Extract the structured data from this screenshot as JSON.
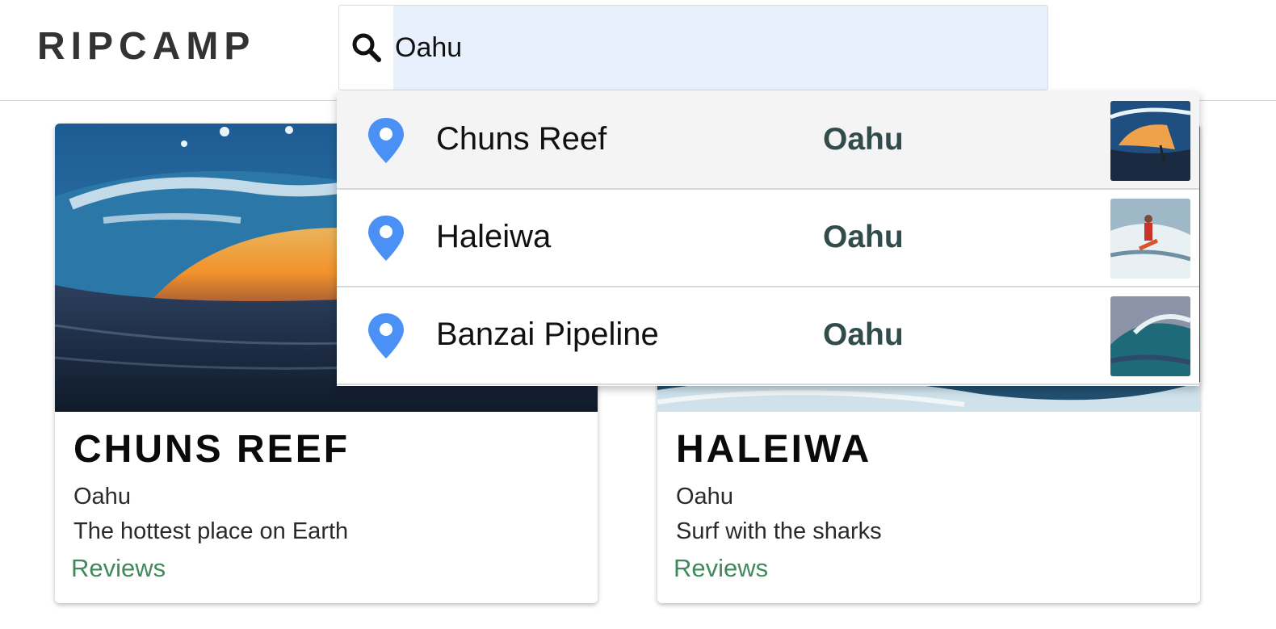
{
  "header": {
    "brand": "RIPCAMP",
    "search": {
      "value": "Oahu",
      "icon": "search-icon"
    }
  },
  "cards": [
    {
      "title": "CHUNS REEF",
      "region": "Oahu",
      "description": "The hottest place on Earth",
      "link_label": "Reviews"
    },
    {
      "title": "HALEIWA",
      "region": "Oahu",
      "description": "Surf with the sharks",
      "link_label": "Reviews"
    }
  ],
  "dropdown": {
    "items": [
      {
        "name": "Chuns Reef",
        "region": "Oahu",
        "icon": "map-pin-icon",
        "highlighted": true
      },
      {
        "name": "Haleiwa",
        "region": "Oahu",
        "icon": "map-pin-icon",
        "highlighted": false
      },
      {
        "name": "Banzai Pipeline",
        "region": "Oahu",
        "icon": "map-pin-icon",
        "highlighted": false
      }
    ]
  },
  "colors": {
    "brand_text": "#333333",
    "search_fill": "#e8f0fe",
    "pin_blue": "#4a90f5",
    "region_text": "#324b4b",
    "link_green": "#3f8a5a"
  }
}
